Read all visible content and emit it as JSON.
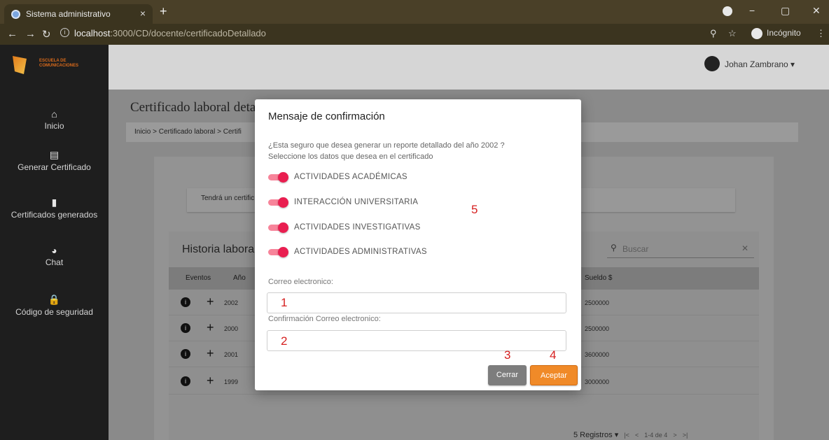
{
  "browser": {
    "tab_title": "Sistema administrativo",
    "tab_close": "×",
    "new_tab": "+",
    "url_host": "localhost",
    "url_path": ":3000/CD/docente/certificadoDetallado",
    "incognito_label": "Incógnito",
    "window_controls": {
      "minimize": "−",
      "restore": "▢",
      "close": "✕"
    }
  },
  "sidebar": {
    "logo_text": "ESCUELA DE COMUNICACIONES",
    "items": [
      {
        "label": "Inicio",
        "icon": "home-icon",
        "glyph": "⌂"
      },
      {
        "label": "Generar Certificado",
        "icon": "book-icon",
        "glyph": "▤"
      },
      {
        "label": "Certificados generados",
        "icon": "file-icon",
        "glyph": "▮"
      },
      {
        "label": "Chat",
        "icon": "chat-icon",
        "glyph": "◕"
      },
      {
        "label": "Código de seguridad",
        "icon": "lock-icon",
        "glyph": "🔒"
      }
    ]
  },
  "header": {
    "user_name": "Johan Zambrano ▾"
  },
  "page": {
    "title": "Certificado laboral deta",
    "breadcrumb": "Inicio > Certificado laboral > Certifi",
    "notice": "Tendrá un certific",
    "history_title": "Historia labora",
    "search_placeholder": "Buscar",
    "table": {
      "headers": {
        "events": "Eventos",
        "year": "Año",
        "salary": "Sueldo $"
      },
      "rows": [
        {
          "year": "2002",
          "salary": "2500000"
        },
        {
          "year": "2000",
          "salary": "2500000"
        },
        {
          "year": "2001",
          "salary": "3600000"
        },
        {
          "year": "1999",
          "salary": "3000000"
        }
      ]
    },
    "pager": {
      "per_page": "5 Registros",
      "range": "1-4 de 4"
    }
  },
  "modal": {
    "title": "Mensaje de confirmación",
    "question": "¿Esta seguro que desea generar un reporte detallado del año 2002 ?",
    "instruction": "Seleccione los datos que desea en el certificado",
    "toggles": [
      {
        "label": "ACTIVIDADES ACADÉMICAS",
        "on": true
      },
      {
        "label": "INTERACCIÓN UNIVERSITARIA",
        "on": true
      },
      {
        "label": "ACTIVIDADES INVESTIGATIVAS",
        "on": true
      },
      {
        "label": "ACTIVIDADES ADMINISTRATIVAS",
        "on": true
      }
    ],
    "email_label": "Correo electronico:",
    "email_confirm_label": "Confirmación Correo electronico:",
    "email_value": "",
    "email_confirm_value": "",
    "close_button": "Cerrar",
    "accept_button": "Aceptar"
  },
  "annotations": {
    "a1": "1",
    "a2": "2",
    "a3": "3",
    "a4": "4",
    "a5": "5"
  },
  "colors": {
    "accent": "#e91e50",
    "accept": "#f08a28",
    "sidebar": "#1e1e1e"
  }
}
